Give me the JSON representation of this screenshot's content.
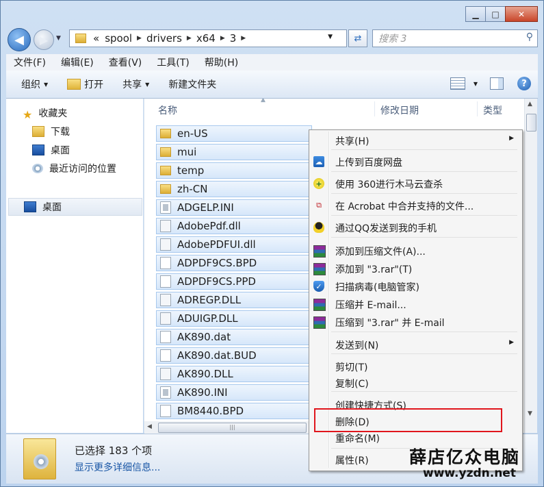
{
  "window": {
    "caption_buttons": {
      "minimize": "▁",
      "maximize": "□",
      "close": "✕"
    }
  },
  "nav": {
    "back_icon": "arrow-left-icon",
    "forward_icon": "arrow-right-icon",
    "breadcrumb": [
      "«",
      "spool",
      "drivers",
      "x64",
      "3"
    ],
    "search_placeholder": "搜索 3"
  },
  "menu": [
    "文件(F)",
    "编辑(E)",
    "查看(V)",
    "工具(T)",
    "帮助(H)"
  ],
  "toolbar": {
    "organize": "组织",
    "open": "打开",
    "share": "共享",
    "new_folder": "新建文件夹",
    "help": "?"
  },
  "sidebar": {
    "favorites": "收藏夹",
    "downloads": "下载",
    "desktop_fav": "桌面",
    "recent": "最近访问的位置",
    "desktop": "桌面"
  },
  "columns": {
    "name": "名称",
    "date": "修改日期",
    "type": "类型"
  },
  "files": [
    {
      "name": "en-US",
      "kind": "folder"
    },
    {
      "name": "mui",
      "kind": "folder"
    },
    {
      "name": "temp",
      "kind": "folder"
    },
    {
      "name": "zh-CN",
      "kind": "folder"
    },
    {
      "name": "ADGELP.INI",
      "kind": "ini"
    },
    {
      "name": "AdobePdf.dll",
      "kind": "dll"
    },
    {
      "name": "AdobePDFUI.dll",
      "kind": "dll"
    },
    {
      "name": "ADPDF9CS.BPD",
      "kind": "doc"
    },
    {
      "name": "ADPDF9CS.PPD",
      "kind": "doc"
    },
    {
      "name": "ADREGP.DLL",
      "kind": "dll"
    },
    {
      "name": "ADUIGP.DLL",
      "kind": "dll"
    },
    {
      "name": "AK890.dat",
      "kind": "doc"
    },
    {
      "name": "AK890.dat.BUD",
      "kind": "doc"
    },
    {
      "name": "AK890.DLL",
      "kind": "dll"
    },
    {
      "name": "AK890.INI",
      "kind": "ini"
    },
    {
      "name": "BM8440.BPD",
      "kind": "doc"
    }
  ],
  "status": {
    "selected": "已选择 183 个项",
    "details": "显示更多详细信息..."
  },
  "context_menu": {
    "items": [
      {
        "label": "共享(H)",
        "icon": "share",
        "submenu": true
      },
      {
        "label": "上传到百度网盘",
        "icon": "baidu-cloud-icon"
      },
      {
        "label": "使用 360进行木马云查杀",
        "icon": "360-icon"
      },
      {
        "label": "在 Acrobat 中合并支持的文件...",
        "icon": "acrobat-icon"
      },
      {
        "label": "通过QQ发送到我的手机",
        "icon": "qq-icon"
      },
      {
        "label": "添加到压缩文件(A)...",
        "icon": "winrar-icon"
      },
      {
        "label": "添加到 \"3.rar\"(T)",
        "icon": "winrar-icon"
      },
      {
        "label": "扫描病毒(电脑管家)",
        "icon": "shield-icon"
      },
      {
        "label": "压缩并 E-mail...",
        "icon": "winrar-icon"
      },
      {
        "label": "压缩到 \"3.rar\" 并 E-mail",
        "icon": "winrar-icon"
      },
      {
        "label": "发送到(N)",
        "submenu": true
      },
      {
        "label": "剪切(T)"
      },
      {
        "label": "复制(C)"
      },
      {
        "label": "创建快捷方式(S)"
      },
      {
        "label": "删除(D)",
        "highlighted": true
      },
      {
        "label": "重命名(M)"
      },
      {
        "label": "属性(R)"
      }
    ]
  },
  "watermark": {
    "line1": "薛店亿众电脑",
    "line2": "www.yzdn.net"
  },
  "colors": {
    "highlight_box": "#e0151c",
    "selection": "#d6e7fa"
  }
}
